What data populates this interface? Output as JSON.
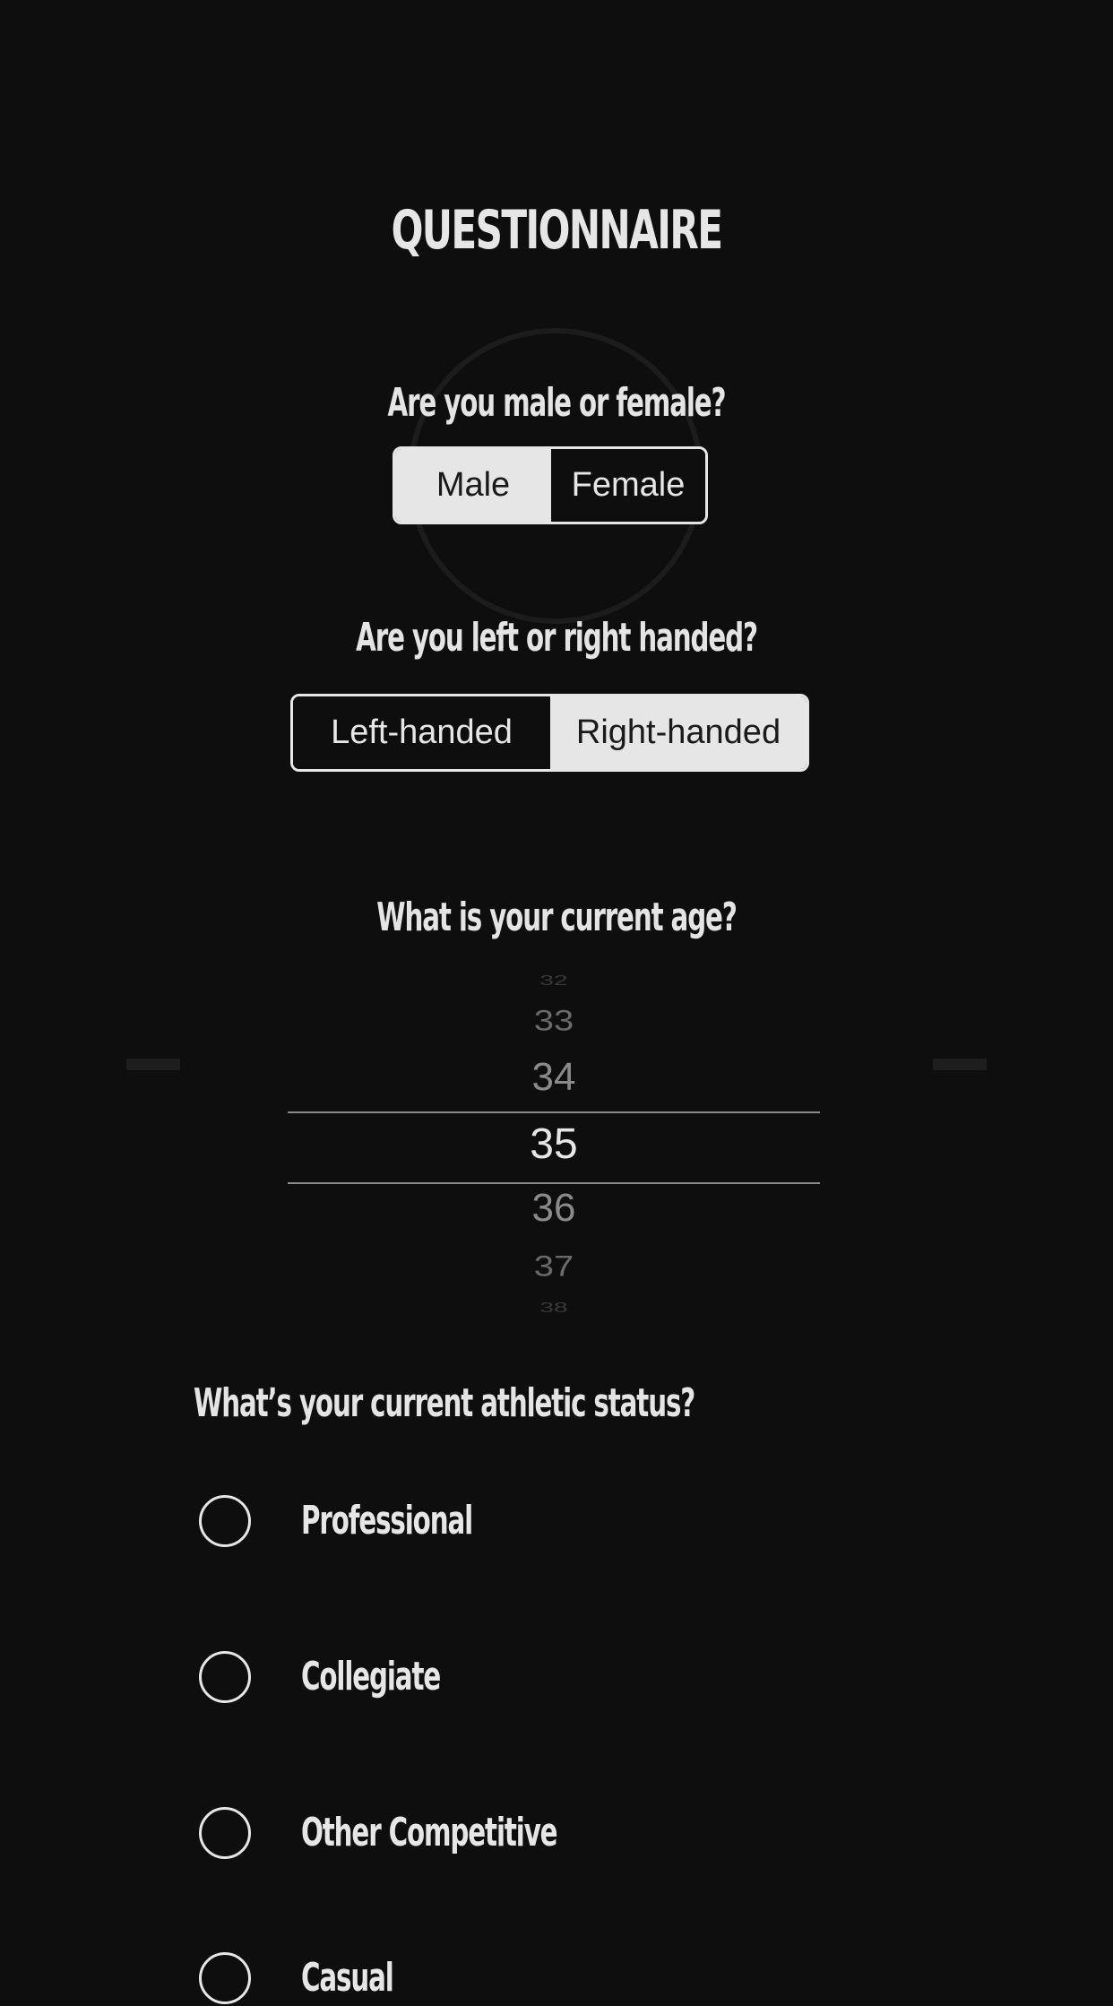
{
  "header": {
    "title": "QUESTIONNAIRE"
  },
  "gender": {
    "question": "Are you male or female?",
    "options": [
      "Male",
      "Female"
    ],
    "selected": "Male"
  },
  "handedness": {
    "question": "Are you left or right handed?",
    "options": [
      "Left-handed",
      "Right-handed"
    ],
    "selected": "Right-handed"
  },
  "age": {
    "question": "What is your current age?",
    "visible_values": [
      "32",
      "33",
      "34",
      "35",
      "36",
      "37",
      "38"
    ],
    "selected": "35"
  },
  "athletic_status": {
    "question": "What’s your current athletic status?",
    "options": [
      "Professional",
      "Collegiate",
      "Other Competitive",
      "Casual"
    ]
  },
  "colors": {
    "background": "#0e0e0e",
    "foreground": "#e6e6e6"
  }
}
